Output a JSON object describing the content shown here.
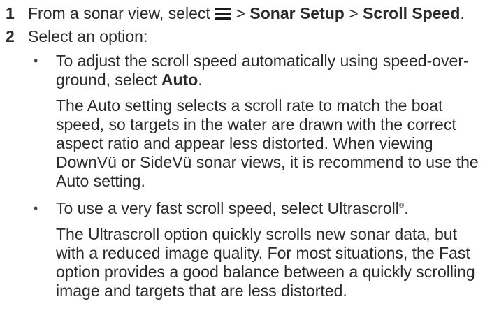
{
  "steps": [
    {
      "number": "1",
      "text_before_icon": "From a sonar view, select",
      "icon": "menu-icon",
      "separator_1": " > ",
      "menu_1": "Sonar Setup",
      "separator_2": " > ",
      "menu_2": "Scroll Speed",
      "end": "."
    },
    {
      "number": "2",
      "text": "Select an option:"
    }
  ],
  "options": [
    {
      "bullet": "•",
      "intro_before": "To adjust the scroll speed automatically using speed-over-ground, select ",
      "intro_bold": "Auto",
      "intro_after": ".",
      "description": "The Auto setting selects a scroll rate to match the boat speed, so targets in the water are drawn with the correct aspect ratio and appear less distorted. When viewing DownVü or SideVü sonar views, it is recommend to use the Auto setting."
    },
    {
      "bullet": "•",
      "intro_before": "To use a very fast scroll speed, select Ultrascroll",
      "intro_sup": "®",
      "intro_after": ".",
      "description": "The Ultrascroll option quickly scrolls new sonar data, but with a reduced image quality. For most situations, the Fast option provides a good balance between a quickly scrolling image and targets that are less distorted."
    }
  ]
}
